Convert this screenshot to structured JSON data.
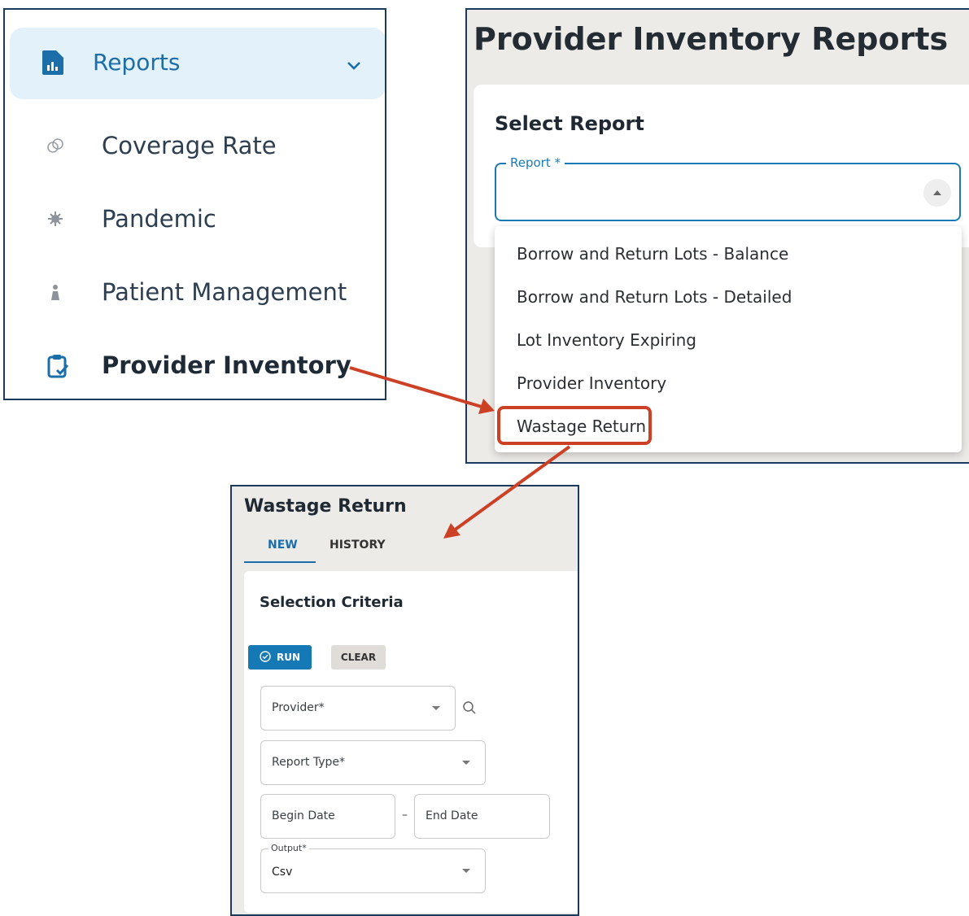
{
  "sidebar": {
    "header": {
      "label": "Reports",
      "icon": "report-chart-icon"
    },
    "items": [
      {
        "label": "Coverage Rate",
        "icon": "coverage-rate-icon"
      },
      {
        "label": "Pandemic",
        "icon": "virus-icon"
      },
      {
        "label": "Patient Management",
        "icon": "patient-icon"
      },
      {
        "label": "Provider Inventory",
        "icon": "clipboard-check-icon",
        "active": true
      }
    ]
  },
  "report_select": {
    "title": "Provider Inventory Reports",
    "card_title": "Select Report",
    "report_field": {
      "label": "Report",
      "required_mark": "*",
      "value": ""
    },
    "options": [
      "Borrow and Return Lots - Balance",
      "Borrow and Return Lots - Detailed",
      "Lot Inventory Expiring",
      "Provider Inventory",
      "Wastage Return"
    ],
    "highlighted_option": "Wastage Return"
  },
  "wastage_form": {
    "title": "Wastage Return",
    "tabs": [
      {
        "label": "NEW",
        "active": true
      },
      {
        "label": "HISTORY",
        "active": false
      }
    ],
    "section_title": "Selection Criteria",
    "run_label": "RUN",
    "clear_label": "CLEAR",
    "provider": {
      "label": "Provider",
      "required_mark": "*"
    },
    "report_type": {
      "label": "Report Type",
      "required_mark": "*"
    },
    "begin_date": {
      "placeholder": "Begin Date"
    },
    "date_separator": "–",
    "end_date": {
      "placeholder": "End Date"
    },
    "output": {
      "label": "Output",
      "required_mark": "*",
      "value": "Csv"
    }
  },
  "colors": {
    "accent": "#1b6ea8",
    "panel_border": "#1c3a5e",
    "annotation_arrow": "#cc4125"
  }
}
